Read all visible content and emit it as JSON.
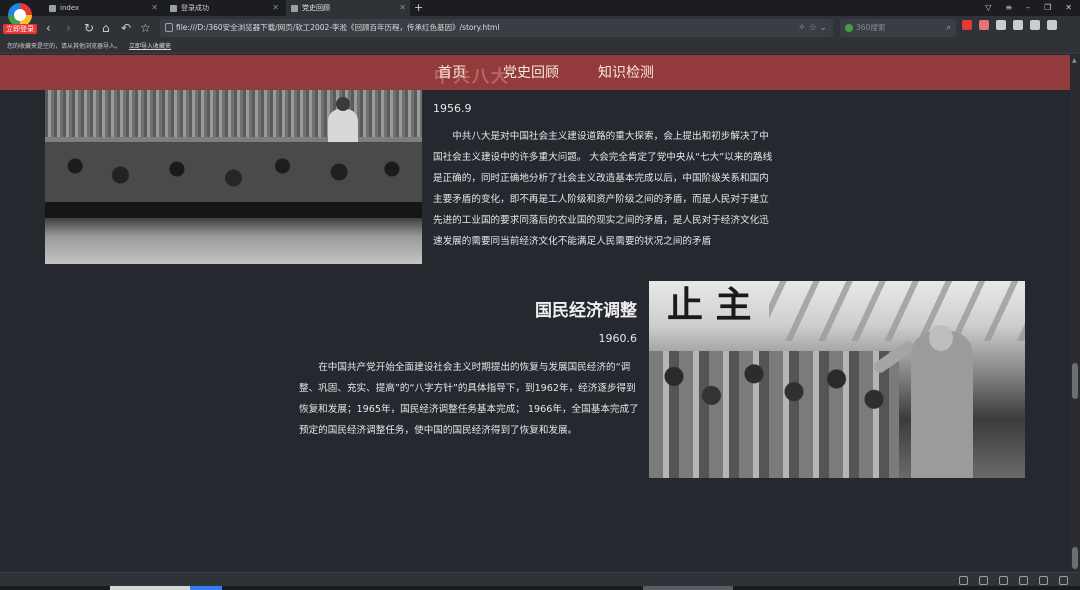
{
  "browser": {
    "badge_label": "立即登录",
    "tabs": [
      {
        "label": "index"
      },
      {
        "label": "登录成功"
      },
      {
        "label": "党史回顾"
      }
    ],
    "address": "file:///D:/360安全浏览器下载/网页/软工2002-李淞《回顾百年历程，传承红色基因》/story.html",
    "search_placeholder": "360搜索",
    "bookmark_bar": {
      "text": "您的收藏夹是空的，请从其他浏览器导入。",
      "link": "立即导入收藏夹"
    }
  },
  "site": {
    "nav": [
      {
        "label": "首页"
      },
      {
        "label": "党史回顾"
      },
      {
        "label": "知识检测"
      }
    ]
  },
  "sections": [
    {
      "title": "中共八大",
      "date": "1956.9",
      "body": "中共八大是对中国社会主义建设道路的重大探索，会上提出和初步解决了中国社会主义建设中的许多重大问题。 大会完全肯定了党中央从“七大”以来的路线是正确的，同时正确地分析了社会主义改造基本完成以后，中国阶级关系和国内主要矛盾的变化，即不再是工人阶级和资产阶级之间的矛盾，而是人民对于建立先进的工业国的要求同落后的农业国的现实之间的矛盾，是人民对于经济文化迅速发展的需要同当前经济文化不能满足人民需要的状况之间的矛盾"
    },
    {
      "title": "国民经济调整",
      "date": "1960.6",
      "body": "在中国共产党开始全面建设社会主义时期提出的恢复与发展国民经济的“调整、巩固、充实、提高”的“八字方针”的具体指导下，到1962年，经济逐步得到恢复和发展；1965年，国民经济调整任务基本完成；  1966年，全国基本完成了预定的国民经济调整任务，使中国的国民经济得到了恢复和发展。",
      "photo_sign": "止 主"
    }
  ],
  "colors": {
    "site_nav_bg": "#933a3c",
    "page_bg": "#25282e",
    "nav_text": "#f6e9d7"
  }
}
